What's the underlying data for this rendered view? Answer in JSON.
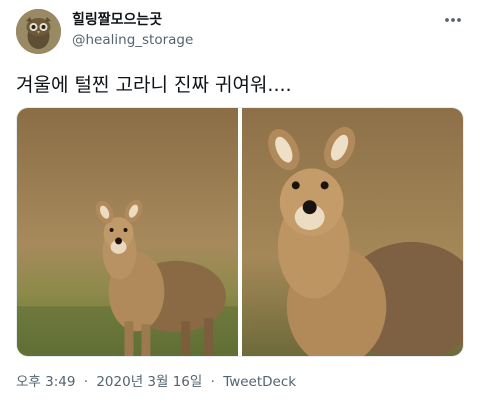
{
  "tweet": {
    "display_name": "힐링짤모으는곳",
    "handle": "@healing_storage",
    "text": "겨울에 털찐 고라니 진짜 귀여워....",
    "time": "오후 3:49",
    "separator": "·",
    "date": "2020년 3월 16일",
    "client": "TweetDeck"
  },
  "icons": {
    "avatar": "avatar-owl-image",
    "more": "more-horizontal-icon"
  },
  "media": [
    {
      "name": "water-deer-photo-1",
      "description_icon": "photo"
    },
    {
      "name": "water-deer-photo-2",
      "description_icon": "photo"
    }
  ],
  "colors": {
    "text_primary": "#0f1419",
    "text_secondary": "#536471",
    "photo_background": "#a07a4a",
    "deer_fur": "#b68a58"
  }
}
